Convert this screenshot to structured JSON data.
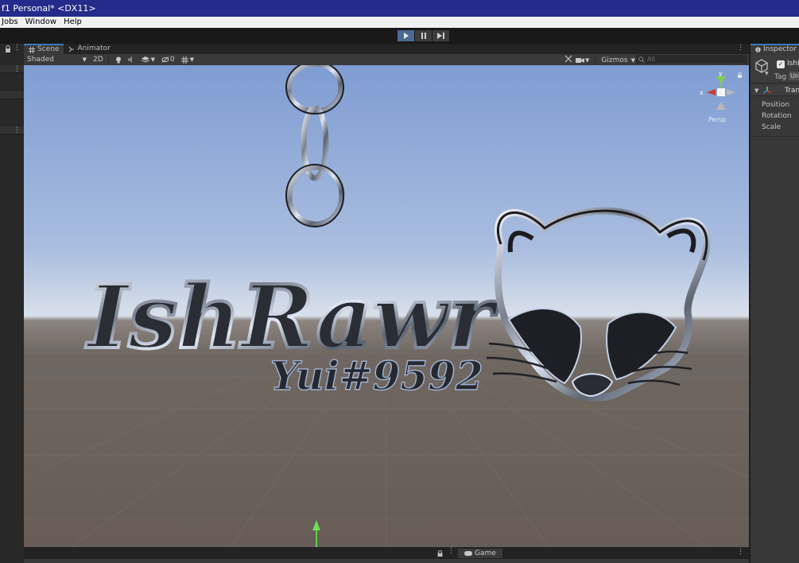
{
  "window": {
    "title": "f1 Personal* <DX11>"
  },
  "menu": {
    "items": [
      "Jobs",
      "Window",
      "Help"
    ]
  },
  "scene_tabs": [
    {
      "label": "Scene",
      "icon": "grid-icon",
      "active": true
    },
    {
      "label": "Animator",
      "icon": "animator-icon",
      "active": false
    }
  ],
  "scene_toolbar": {
    "shading_mode": "Shaded",
    "toggle_2d": "2D",
    "fx_count": "0",
    "gizmos_label": "Gizmos",
    "search_placeholder": "All"
  },
  "gizmo": {
    "projection_label": "Persp",
    "y_axis": "y",
    "x_axis": "x"
  },
  "scene_text": {
    "main": "IshRawr",
    "sub": "Yui#9592"
  },
  "bottom_tabs": [
    {
      "label": "Game",
      "icon": "gamepad-icon"
    }
  ],
  "inspector": {
    "tab_label": "Inspector",
    "object_name": "IshR",
    "tag_label": "Tag",
    "tag_value": "Unt",
    "component_label": "Trans",
    "properties": [
      "Position",
      "Rotation",
      "Scale"
    ]
  },
  "colors": {
    "title_bar": "#242b8a",
    "accent": "#3a79bb",
    "play_active": "#4b6a93",
    "sky_top": "#7f9cd2",
    "ground": "#645a54"
  }
}
